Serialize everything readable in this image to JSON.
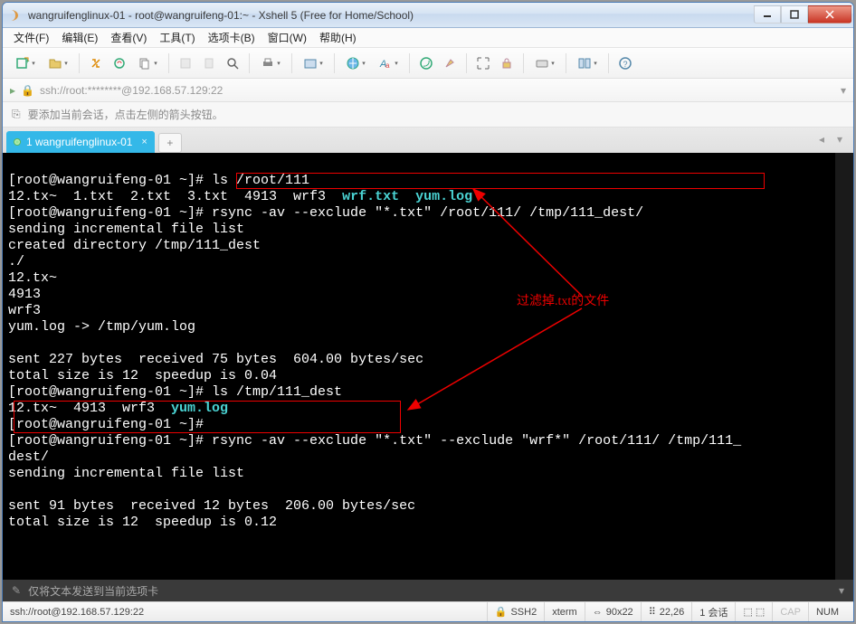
{
  "window": {
    "title": "wangruifenglinux-01 - root@wangruifeng-01:~ - Xshell 5 (Free for Home/School)"
  },
  "menu": {
    "file": "文件(F)",
    "edit": "编辑(E)",
    "view": "查看(V)",
    "tools": "工具(T)",
    "tabs": "选项卡(B)",
    "window": "窗口(W)",
    "help": "帮助(H)"
  },
  "addressbar": {
    "url": "ssh://root:********@192.168.57.129:22"
  },
  "hintbar": {
    "text": "要添加当前会话，点击左侧的箭头按钮。"
  },
  "tab": {
    "label": "1 wangruifenglinux-01"
  },
  "terminal": {
    "line01_a": "[root@wangruifeng-01 ~]# ls /root/111",
    "line02_a": "12.tx~  1.txt  2.txt  3.txt  4913  wrf3  ",
    "line02_b": "wrf.txt",
    "line02_c": "  ",
    "line02_d": "yum.log",
    "line03": "[root@wangruifeng-01 ~]# rsync -av --exclude \"*.txt\" /root/111/ /tmp/111_dest/",
    "line04": "sending incremental file list",
    "line05": "created directory /tmp/111_dest",
    "line06": "./",
    "line07": "12.tx~",
    "line08": "4913",
    "line09": "wrf3",
    "line10": "yum.log -> /tmp/yum.log",
    "line11": "",
    "line12": "sent 227 bytes  received 75 bytes  604.00 bytes/sec",
    "line13": "total size is 12  speedup is 0.04",
    "line14": "[root@wangruifeng-01 ~]# ls /tmp/111_dest",
    "line15_a": "12.tx~  4913  wrf3  ",
    "line15_b": "yum.log",
    "line16": "[root@wangruifeng-01 ~]#",
    "line17": "[root@wangruifeng-01 ~]# rsync -av --exclude \"*.txt\" --exclude \"wrf*\" /root/111/ /tmp/111_",
    "line18": "dest/",
    "line19": "sending incremental file list",
    "line20": "",
    "line21": "sent 91 bytes  received 12 bytes  206.00 bytes/sec",
    "line22": "total size is 12  speedup is 0.12"
  },
  "annotation": {
    "text": "过滤掉.txt的文件"
  },
  "footer1": {
    "text": "仅将文本发送到当前选项卡"
  },
  "statusbar": {
    "conn": "ssh://root@192.168.57.129:22",
    "proto": "SSH2",
    "term": "xterm",
    "size": "90x22",
    "pos": "22,26",
    "sessions": "1 会话",
    "caps": "CAP",
    "num": "NUM"
  }
}
